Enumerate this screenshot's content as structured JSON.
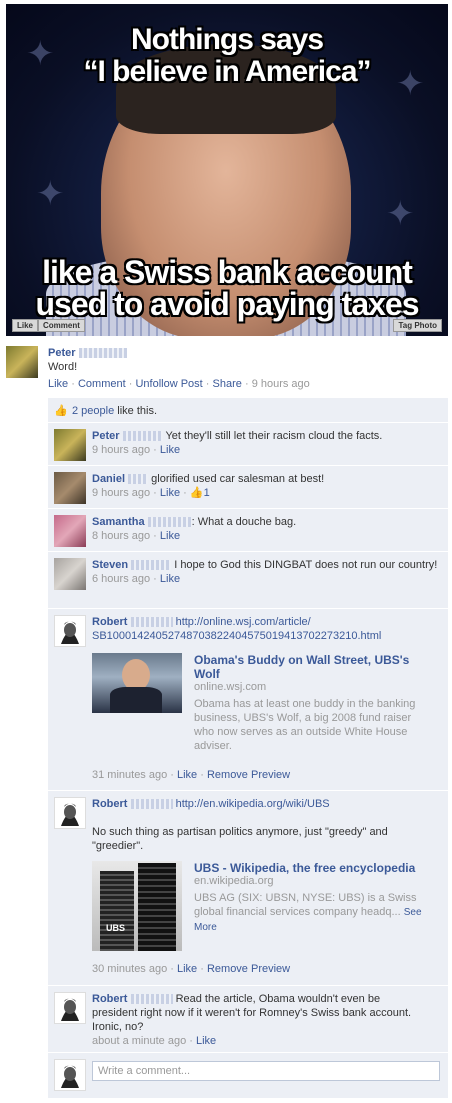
{
  "photo": {
    "caption_top_line1": "Nothings says",
    "caption_top_line2": "“I believe in America”",
    "caption_bottom_line1": "like a Swiss bank account",
    "caption_bottom_line2": "used to avoid paying taxes",
    "like_label": "Like",
    "comment_label": "Comment",
    "tag_label": "Tag Photo"
  },
  "post": {
    "author": "Peter",
    "message": "Word!",
    "actions": {
      "like": "Like",
      "comment": "Comment",
      "unfollow": "Unfollow Post",
      "share": "Share",
      "time": "9 hours ago",
      "sep": "·"
    },
    "likes_summary_count": "2 people",
    "likes_summary_rest": " like this."
  },
  "comments": [
    {
      "author": "Peter",
      "text": "Yet they'll still let their racism cloud the facts.",
      "time": "9 hours ago",
      "like": "Like"
    },
    {
      "author": "Daniel",
      "text": "glorified used car salesman at best!",
      "time": "9 hours ago",
      "like": "Like",
      "likes": "1"
    },
    {
      "author": "Samantha",
      "text": ": What a douche bag.",
      "time": "8 hours ago",
      "like": "Like"
    },
    {
      "author": "Steven",
      "text": "I hope to God this DINGBAT does not run our country!",
      "time": "6 hours ago",
      "like": "Like"
    },
    {
      "author": "Robert",
      "link_line1": "http://online.wsj.com/article/",
      "link_line2": "SB10001424052748703822404575019413702273210.html",
      "preview_title": "Obama's Buddy on Wall Street, UBS's Wolf",
      "preview_source": "online.wsj.com",
      "preview_desc": "Obama has at least one buddy in the banking business, UBS's Wolf, a big 2008 fund raiser who now serves as an outside White House adviser.",
      "time": "31 minutes ago",
      "like": "Like",
      "remove": "Remove Preview"
    },
    {
      "author": "Robert",
      "link_line1": "http://en.wikipedia.org/wiki/UBS",
      "text": "No such thing as partisan politics anymore, just \"greedy\" and \"greedier\".",
      "preview_title": "UBS - Wikipedia, the free encyclopedia",
      "preview_source": "en.wikipedia.org",
      "preview_desc": "UBS AG (SIX: UBSN, NYSE: UBS) is a Swiss global financial services company headq...",
      "see_more": "See More",
      "image_label": "UBS",
      "time": "30 minutes ago",
      "like": "Like",
      "remove": "Remove Preview"
    },
    {
      "author": "Robert",
      "text": "Read the article, Obama wouldn't even be president right now if it weren't for Romney's Swiss bank account. Ironic, no?",
      "time": "about a minute ago",
      "like": "Like"
    }
  ],
  "composer": {
    "placeholder": "Write a comment..."
  }
}
